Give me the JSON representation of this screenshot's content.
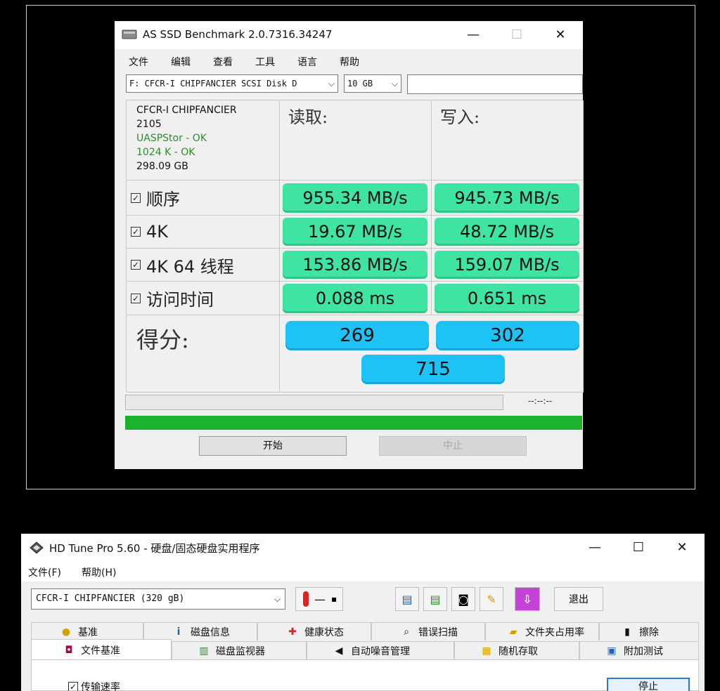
{
  "asssd": {
    "title": "AS SSD Benchmark 2.0.7316.34247",
    "window_controls": {
      "minimize": "—",
      "maximize": "☐",
      "close": "✕"
    },
    "menu": [
      "文件",
      "编辑",
      "查看",
      "工具",
      "语言",
      "帮助"
    ],
    "drive_select": "F: CFCR-I CHIPFANCIER SCSI Disk D",
    "size_select": "10 GB",
    "drive_info": {
      "name": "CFCR-I CHIPFANCIER",
      "firmware": "2105",
      "driver": "UASPStor - OK",
      "alignment": "1024 K - OK",
      "capacity": "298.09 GB"
    },
    "col_read": "读取:",
    "col_write": "写入:",
    "rows": [
      {
        "label": "顺序",
        "read": "955.34 MB/s",
        "write": "945.73 MB/s"
      },
      {
        "label": "4K",
        "read": "19.67 MB/s",
        "write": "48.72 MB/s"
      },
      {
        "label": "4K 64 线程",
        "read": "153.86 MB/s",
        "write": "159.07 MB/s"
      },
      {
        "label": "访问时间",
        "read": "0.088 ms",
        "write": "0.651 ms"
      }
    ],
    "score_label": "得分:",
    "score_read": "269",
    "score_write": "302",
    "score_total": "715",
    "timer": "--:--:--",
    "start_button": "开始",
    "stop_button": "中止"
  },
  "hdtune": {
    "title": "HD Tune Pro 5.60 - 硬盘/固态硬盘实用程序",
    "window_controls": {
      "minimize": "—",
      "maximize": "☐",
      "close": "✕"
    },
    "menu": [
      "文件(F)",
      "帮助(H)"
    ],
    "drive_select": "CFCR-I  CHIPFANCIER (320 gB)",
    "temperature": "—",
    "exit_button": "退出",
    "tabs_back": [
      "基准",
      "磁盘信息",
      "健康状态",
      "错误扫描",
      "文件夹占用率",
      "擦除"
    ],
    "tabs_front": [
      "文件基准",
      "磁盘监视器",
      "自动噪音管理",
      "随机存取",
      "附加测试"
    ],
    "checkbox_label": "传输速率",
    "stop_button": "停止"
  }
}
